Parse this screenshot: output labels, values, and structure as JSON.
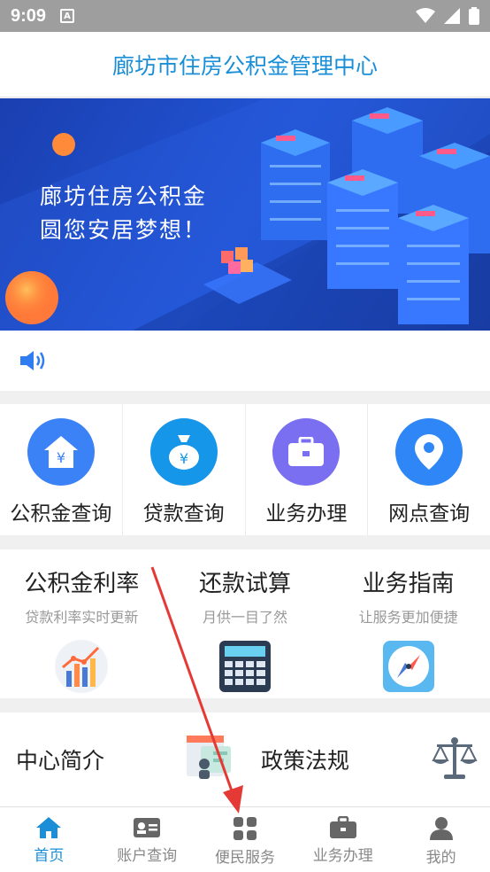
{
  "status": {
    "time": "9:09",
    "a_glyph": "A"
  },
  "header": {
    "title": "廊坊市住房公积金管理中心"
  },
  "banner": {
    "line1": "廊坊住房公积金",
    "line2": "圆您安居梦想！"
  },
  "quick": [
    {
      "label": "公积金查询",
      "color": "#3b82f6",
      "icon": "house-yen-icon"
    },
    {
      "label": "贷款查询",
      "color": "#1596e8",
      "icon": "money-bag-icon"
    },
    {
      "label": "业务办理",
      "color": "#7a6ff0",
      "icon": "briefcase-icon"
    },
    {
      "label": "网点查询",
      "color": "#2f86f6",
      "icon": "location-pin-icon"
    }
  ],
  "features": [
    {
      "title": "公积金利率",
      "sub": "贷款利率实时更新",
      "icon": "chart-icon"
    },
    {
      "title": "还款试算",
      "sub": "月供一目了然",
      "icon": "calculator-icon"
    },
    {
      "title": "业务指南",
      "sub": "让服务更加便捷",
      "icon": "compass-icon"
    }
  ],
  "info": [
    {
      "title": "中心简介",
      "icon": "id-card-icon"
    },
    {
      "title": "政策法规",
      "icon": "scales-icon"
    }
  ],
  "tabs": [
    {
      "label": "首页",
      "icon": "home-icon",
      "active": true
    },
    {
      "label": "账户查询",
      "icon": "account-card-icon",
      "active": false
    },
    {
      "label": "便民服务",
      "icon": "grid-icon",
      "active": false
    },
    {
      "label": "业务办理",
      "icon": "briefcase-icon",
      "active": false
    },
    {
      "label": "我的",
      "icon": "person-icon",
      "active": false
    }
  ],
  "colors": {
    "accent": "#1a8fd8",
    "arrow": "#e53935"
  }
}
